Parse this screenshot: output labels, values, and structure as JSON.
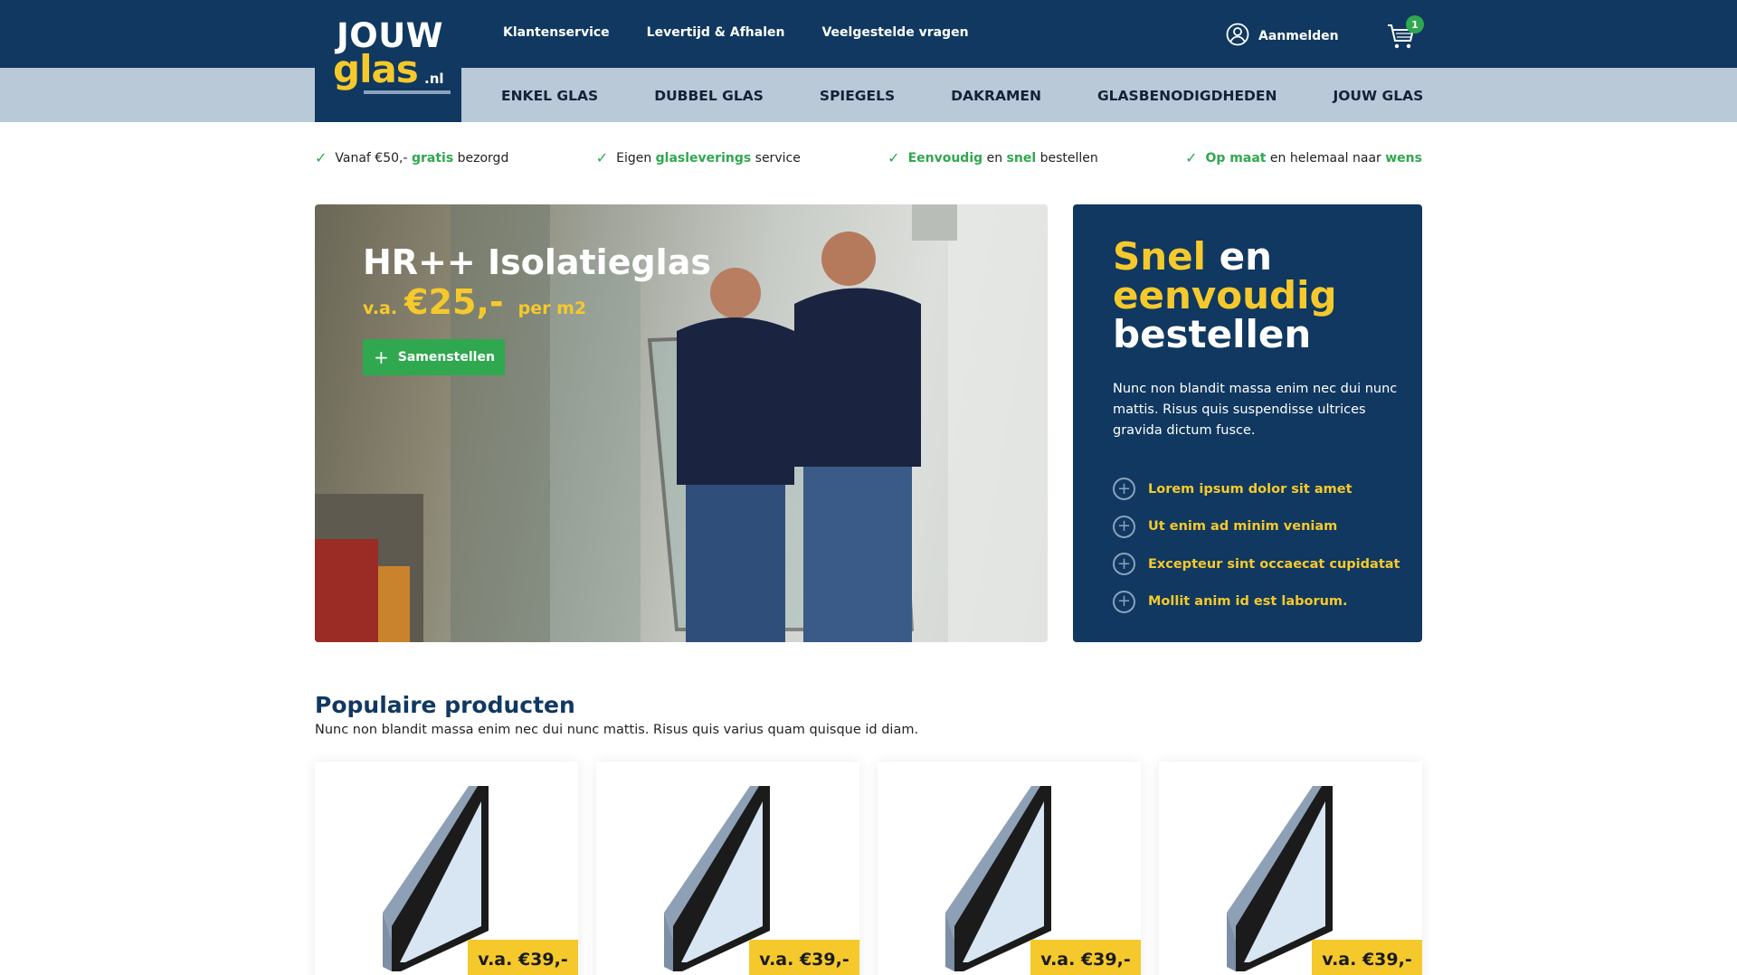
{
  "brand": {
    "logo_top": "JOUW",
    "logo_main": "glas",
    "logo_suffix": ".nl"
  },
  "topnav": {
    "links": [
      "Klantenservice",
      "Levertijd & Afhalen",
      "Veelgestelde vragen"
    ],
    "login_label": "Aanmelden",
    "cart_count": "1"
  },
  "categories": [
    "ENKEL GLAS",
    "DUBBEL GLAS",
    "SPIEGELS",
    "DAKRAMEN",
    "GLASBENODIGDHEDEN",
    "JOUW GLAS"
  ],
  "usps": [
    {
      "a": "Vanaf €50,- ",
      "b": "gratis",
      "c": " bezorgd"
    },
    {
      "a": "Eigen ",
      "b": "glasleverings",
      "c": " service"
    },
    {
      "a": "",
      "b": "Eenvoudig",
      "c": " en ",
      "d": "snel",
      "e": " bestellen"
    },
    {
      "a": "",
      "b": "Op maat",
      "c": " en helemaal naar ",
      "d": "wens"
    }
  ],
  "hero": {
    "title": "HR++ Isolatieglas",
    "price_prefix": "v.a.",
    "price": "€25,-",
    "price_suffix": "per m2",
    "button_label": "Samenstellen"
  },
  "panel": {
    "title_yellow_1": "Snel",
    "title_white_1": " en",
    "title_yellow_2": "eenvoudig",
    "title_white_2": "bestellen",
    "text": "Nunc non blandit massa enim nec dui nunc mattis. Risus quis suspendisse ultrices gravida dictum fusce.",
    "items": [
      "Lorem ipsum dolor sit amet",
      "Ut enim ad minim veniam",
      "Excepteur sint occaecat cupidatat",
      "Mollit anim id est laborum."
    ]
  },
  "popular": {
    "title": "Populaire producten",
    "subtitle": "Nunc non blandit massa enim nec dui nunc mattis. Risus quis varius quam quisque id diam.",
    "products": [
      {
        "price": "v.a. €39,-"
      },
      {
        "price": "v.a. €39,-"
      },
      {
        "price": "v.a. €39,-"
      },
      {
        "price": "v.a. €39,-"
      }
    ]
  },
  "colors": {
    "navy": "#103860",
    "yellow": "#f5c92c",
    "green": "#2fa84f",
    "catbar": "#bac9d8"
  }
}
